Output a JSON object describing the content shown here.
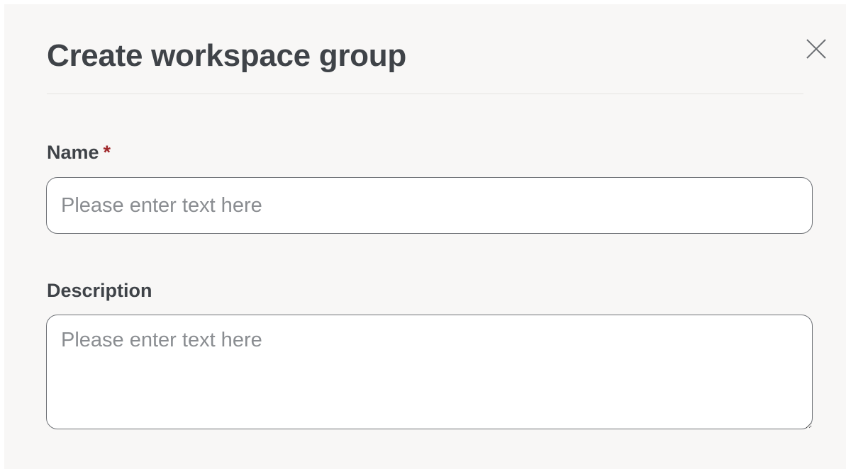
{
  "dialog": {
    "title": "Create workspace group",
    "close_icon": "close-icon"
  },
  "fields": {
    "name": {
      "label": "Name",
      "required_marker": "*",
      "value": "",
      "placeholder": "Please enter text here"
    },
    "description": {
      "label": "Description",
      "value": "",
      "placeholder": "Please enter text here"
    }
  },
  "colors": {
    "panel_background": "#f8f7f6",
    "text": "#3f4348",
    "required": "#a0282b",
    "input_border": "#6e7176",
    "placeholder": "#8a8d91"
  }
}
